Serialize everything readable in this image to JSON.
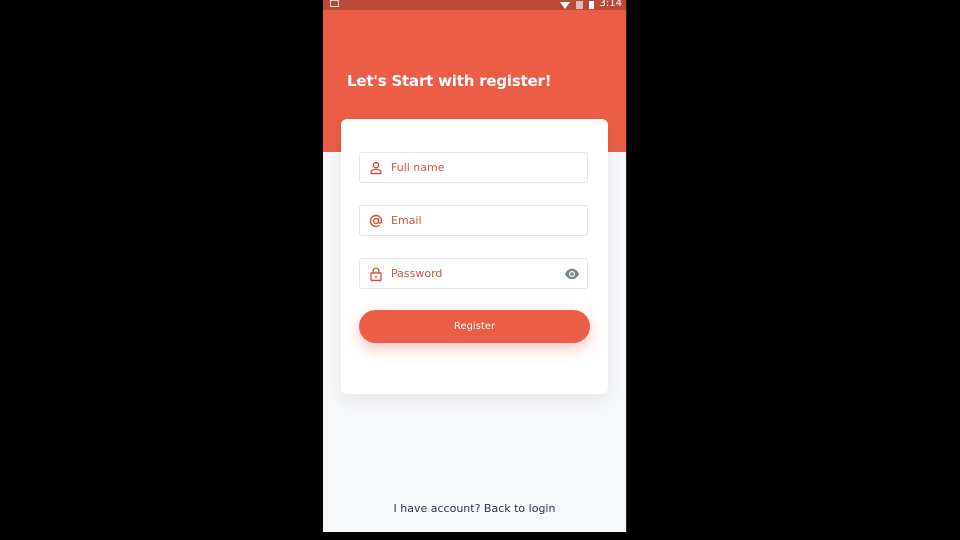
{
  "status_bar": {
    "time": "3:14",
    "icons": [
      "image-icon",
      "wifi-icon",
      "no-sim-icon",
      "battery-icon"
    ]
  },
  "header": {
    "title": "Let's Start with register!"
  },
  "form": {
    "full_name": {
      "placeholder": "Full name",
      "icon": "person-icon"
    },
    "email": {
      "placeholder": "Email",
      "icon": "at-sign-icon"
    },
    "password": {
      "placeholder": "Password",
      "icon": "lock-icon",
      "toggle_icon": "eye-icon"
    },
    "register_label": "Register"
  },
  "footer": {
    "login_link": "I have account? Back to login"
  },
  "colors": {
    "primary": "#eb5d46",
    "status_bar": "#b94a38",
    "background": "#f7f8fa",
    "text_dark": "#2f3550"
  }
}
